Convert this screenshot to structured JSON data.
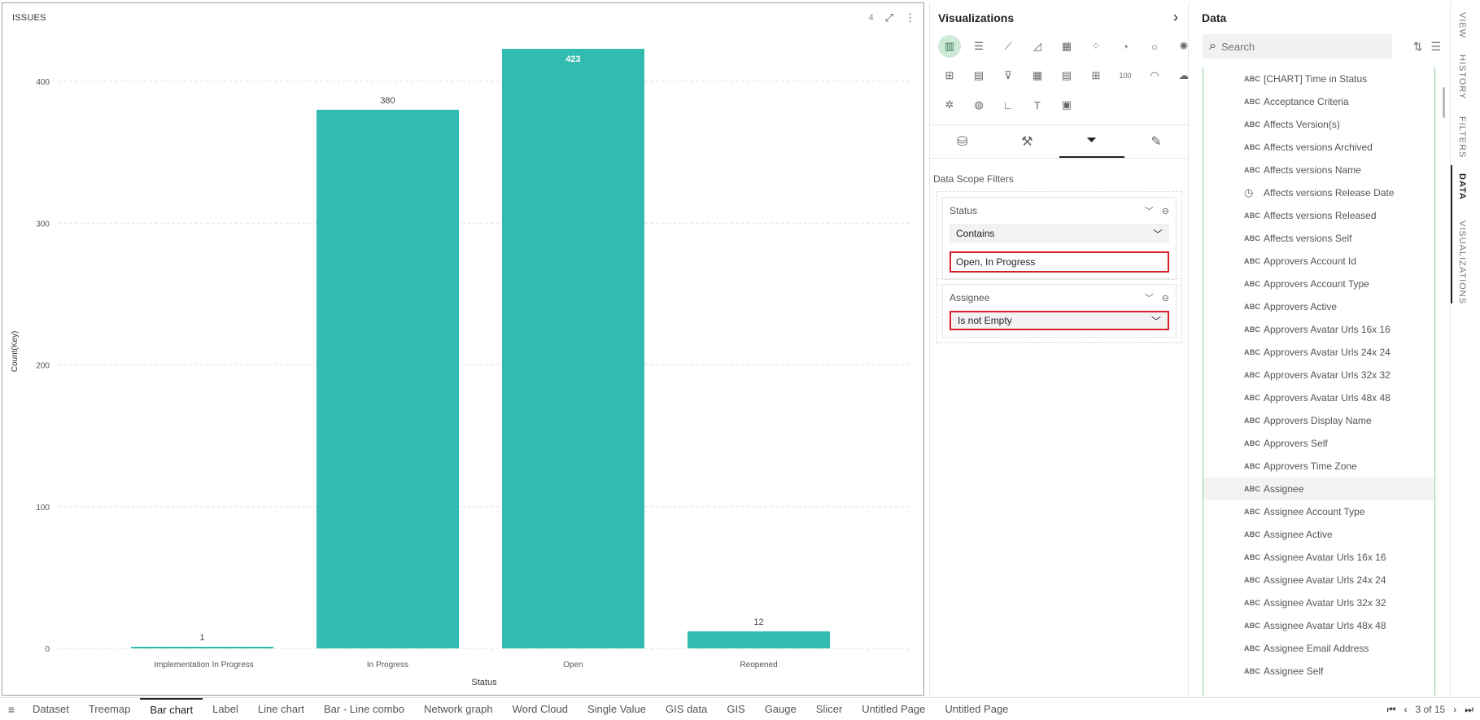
{
  "chart_panel": {
    "title": "ISSUES",
    "count": "4",
    "expand_icon": "expand-icon",
    "menu_icon": "kebab-menu-icon"
  },
  "chart_data": {
    "type": "bar",
    "categories": [
      "Implementation In Progress",
      "In Progress",
      "Open",
      "Reopened"
    ],
    "values": [
      1,
      380,
      423,
      12
    ],
    "data_labels": [
      "1",
      "380",
      "423",
      "12"
    ],
    "xlabel": "Status",
    "ylabel": "Count(Key)",
    "ylim": [
      0,
      423
    ],
    "yticks": [
      0,
      100,
      200,
      300,
      400
    ],
    "ytick_labels": [
      "0",
      "100",
      "200",
      "300",
      "400"
    ],
    "grid": true,
    "bar_color": "#32bcb1"
  },
  "viz_pane": {
    "title": "Visualizations",
    "collapse_icon": "chevron-right-icon",
    "icons": [
      {
        "name": "column-chart-icon",
        "glyph": "▥",
        "active": true
      },
      {
        "name": "bar-chart-icon",
        "glyph": "☰"
      },
      {
        "name": "line-chart-icon",
        "glyph": "⟋"
      },
      {
        "name": "area-chart-icon",
        "glyph": "◿"
      },
      {
        "name": "combo-chart-icon",
        "glyph": "▦"
      },
      {
        "name": "scatter-chart-icon",
        "glyph": "⁘"
      },
      {
        "name": "pie-chart-icon",
        "glyph": "◔"
      },
      {
        "name": "donut-chart-icon",
        "glyph": "○"
      },
      {
        "name": "sunburst-icon",
        "glyph": "✺"
      },
      {
        "name": "treemap-icon",
        "glyph": "⊞"
      },
      {
        "name": "card-icon",
        "glyph": "▤"
      },
      {
        "name": "funnel-icon",
        "glyph": "⊽"
      },
      {
        "name": "table-icon",
        "glyph": "▦"
      },
      {
        "name": "pivot-table-icon",
        "glyph": "▤"
      },
      {
        "name": "grid-icon",
        "glyph": "⊞"
      },
      {
        "name": "single-value-icon",
        "glyph": "100"
      },
      {
        "name": "gauge-icon",
        "glyph": "◠"
      },
      {
        "name": "word-cloud-icon",
        "glyph": "☁"
      },
      {
        "name": "network-graph-icon",
        "glyph": "✲"
      },
      {
        "name": "globe-icon",
        "glyph": "◍"
      },
      {
        "name": "axis-chart-icon",
        "glyph": "∟"
      },
      {
        "name": "text-icon",
        "glyph": "T"
      },
      {
        "name": "calendar-icon",
        "glyph": "▣"
      }
    ],
    "tabs": [
      {
        "name": "tab-data-source",
        "glyph": "⛁"
      },
      {
        "name": "tab-format",
        "glyph": "⚒"
      },
      {
        "name": "tab-filters",
        "glyph": "⏷",
        "active": true
      },
      {
        "name": "tab-analytics",
        "glyph": "✎"
      }
    ],
    "data_scope_label": "Data Scope Filters",
    "filters": {
      "status": {
        "name": "Status",
        "operator": "Contains",
        "value": "Open, In Progress"
      },
      "assignee": {
        "name": "Assignee",
        "operator": "Is not Empty"
      }
    }
  },
  "data_pane": {
    "title": "Data",
    "search_placeholder": "Search",
    "fields": [
      {
        "type": "ABC",
        "label": "[CHART] Time in Status"
      },
      {
        "type": "ABC",
        "label": "Acceptance Criteria"
      },
      {
        "type": "ABC",
        "label": "Affects Version(s)"
      },
      {
        "type": "ABC",
        "label": "Affects versions Archived"
      },
      {
        "type": "ABC",
        "label": "Affects versions Name"
      },
      {
        "type": "clock",
        "label": "Affects versions Release Date"
      },
      {
        "type": "ABC",
        "label": "Affects versions Released"
      },
      {
        "type": "ABC",
        "label": "Affects versions Self"
      },
      {
        "type": "ABC",
        "label": "Approvers Account Id"
      },
      {
        "type": "ABC",
        "label": "Approvers Account Type"
      },
      {
        "type": "ABC",
        "label": "Approvers Active"
      },
      {
        "type": "ABC",
        "label": "Approvers Avatar Urls 16x 16"
      },
      {
        "type": "ABC",
        "label": "Approvers Avatar Urls 24x 24"
      },
      {
        "type": "ABC",
        "label": "Approvers Avatar Urls 32x 32"
      },
      {
        "type": "ABC",
        "label": "Approvers Avatar Urls 48x 48"
      },
      {
        "type": "ABC",
        "label": "Approvers Display Name"
      },
      {
        "type": "ABC",
        "label": "Approvers Self"
      },
      {
        "type": "ABC",
        "label": "Approvers Time Zone"
      },
      {
        "type": "ABC",
        "label": "Assignee",
        "selected": true
      },
      {
        "type": "ABC",
        "label": "Assignee Account Type"
      },
      {
        "type": "ABC",
        "label": "Assignee Active"
      },
      {
        "type": "ABC",
        "label": "Assignee Avatar Urls 16x 16"
      },
      {
        "type": "ABC",
        "label": "Assignee Avatar Urls 24x 24"
      },
      {
        "type": "ABC",
        "label": "Assignee Avatar Urls 32x 32"
      },
      {
        "type": "ABC",
        "label": "Assignee Avatar Urls 48x 48"
      },
      {
        "type": "ABC",
        "label": "Assignee Email Address"
      },
      {
        "type": "ABC",
        "label": "Assignee Self"
      }
    ]
  },
  "side_tabs": [
    {
      "label": "VIEW"
    },
    {
      "label": "HISTORY"
    },
    {
      "label": "FILTERS"
    },
    {
      "label": "DATA",
      "active": true
    },
    {
      "label": "VISUALIZATIONS"
    }
  ],
  "page_tabs": [
    {
      "label": "Dataset"
    },
    {
      "label": "Treemap"
    },
    {
      "label": "Bar chart",
      "active": true
    },
    {
      "label": "Label"
    },
    {
      "label": "Line chart"
    },
    {
      "label": "Bar - Line combo"
    },
    {
      "label": "Network graph"
    },
    {
      "label": "Word Cloud"
    },
    {
      "label": "Single Value"
    },
    {
      "label": "GIS data"
    },
    {
      "label": "GIS"
    },
    {
      "label": "Gauge"
    },
    {
      "label": "Slicer"
    },
    {
      "label": "Untitled Page"
    },
    {
      "label": "Untitled Page"
    }
  ],
  "pager": {
    "text": "3 of 15"
  }
}
